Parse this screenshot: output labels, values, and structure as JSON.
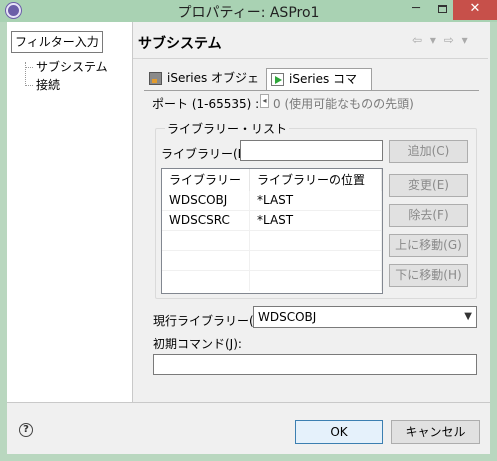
{
  "window": {
    "title": "プロパティー: ASPro1",
    "controls": {
      "minimize": "─",
      "maximize": "",
      "close": "✕"
    }
  },
  "sidebar": {
    "filter_placeholder": "フィルター入力",
    "items": [
      {
        "label": "サブシステム"
      },
      {
        "label": "接続"
      }
    ]
  },
  "page": {
    "title": "サブシステム",
    "nav_arrows": "⇦ ▾ ⇨ ▾"
  },
  "tabs": [
    {
      "label": "iSeries オブジェクト",
      "icon": "objects-icon",
      "selected": false
    },
    {
      "label": "iSeries コマンド",
      "icon": "command-run-icon",
      "selected": true
    }
  ],
  "form": {
    "port_label": "ポート (1-65535) :",
    "port_spinner": "◂",
    "port_value": "0 (使用可能なものの先頭)",
    "library_list_group": "ライブラリー・リスト",
    "library_label": "ライブラリー(B):",
    "library_value": "",
    "buttons": {
      "add": "追加(C)",
      "edit": "変更(E)",
      "remove": "除去(F)",
      "move_up": "上に移動(G)",
      "move_down": "下に移動(H)"
    },
    "table": {
      "columns": [
        "ライブラリー",
        "ライブラリーの位置"
      ],
      "rows": [
        [
          "WDSCOBJ",
          "*LAST"
        ],
        [
          "WDSCSRC",
          "*LAST"
        ]
      ]
    },
    "current_library_label": "現行ライブラリー(I):",
    "current_library_value": "WDSCOBJ",
    "initial_command_label": "初期コマンド(J):",
    "initial_command_value": ""
  },
  "footer": {
    "help": "?",
    "ok": "OK",
    "cancel": "キャンセル"
  }
}
